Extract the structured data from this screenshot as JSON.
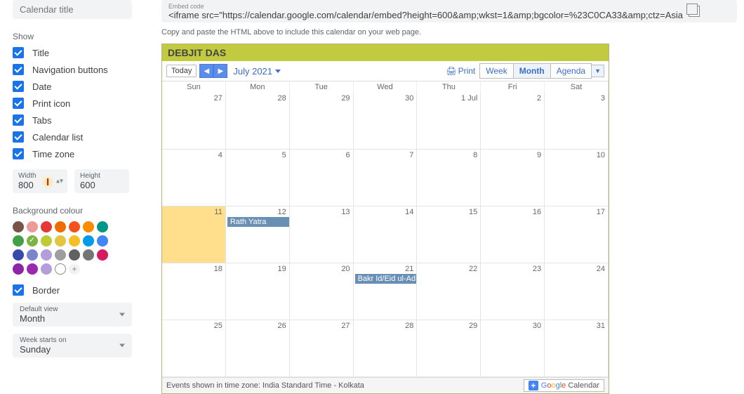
{
  "sidebar": {
    "title_placeholder": "Calendar title",
    "show_label": "Show",
    "checks": [
      {
        "label": "Title"
      },
      {
        "label": "Navigation buttons"
      },
      {
        "label": "Date"
      },
      {
        "label": "Print icon"
      },
      {
        "label": "Tabs"
      },
      {
        "label": "Calendar list"
      },
      {
        "label": "Time zone"
      }
    ],
    "width_label": "Width",
    "width_value": "800",
    "height_label": "Height",
    "height_value": "600",
    "bg_label": "Background colour",
    "colors": [
      "#795548",
      "#ef9a9a",
      "#e53935",
      "#ef6c00",
      "#f4511e",
      "#fb8c00",
      "#009688",
      "#43a047",
      "#7cb342",
      "#c0ca33",
      "#e4c441",
      "#f6bf26",
      "#039be5",
      "#4285f4",
      "#3949ab",
      "#7986cb",
      "#b39ddb",
      "#9e9e9e",
      "#616161",
      "#757575",
      "#d81b60",
      "#8e24aa",
      "#9c27b0",
      "#b39ddb"
    ],
    "selected_color_index": 8,
    "border_label": "Border",
    "default_view_label": "Default view",
    "default_view_value": "Month",
    "week_starts_label": "Week starts on",
    "week_starts_value": "Sunday"
  },
  "main": {
    "embed_label": "Embed code",
    "embed_value": "<iframe src=\"https://calendar.google.com/calendar/embed?height=600&amp;wkst=1&amp;bgcolor=%23C0CA33&amp;ctz=Asia",
    "help_text": "Copy and paste the HTML above to include this calendar on your web page.",
    "calendar": {
      "owner": "DEBJIT DAS",
      "today": "Today",
      "month": "July 2021",
      "print": "Print",
      "tabs": [
        "Week",
        "Month",
        "Agenda"
      ],
      "active_tab": 1,
      "weekdays": [
        "Sun",
        "Mon",
        "Tue",
        "Wed",
        "Thu",
        "Fri",
        "Sat"
      ],
      "cells": [
        {
          "n": "27"
        },
        {
          "n": "28"
        },
        {
          "n": "29"
        },
        {
          "n": "30"
        },
        {
          "n": "1 Jul"
        },
        {
          "n": "2"
        },
        {
          "n": "3"
        },
        {
          "n": "4"
        },
        {
          "n": "5"
        },
        {
          "n": "6"
        },
        {
          "n": "7"
        },
        {
          "n": "8"
        },
        {
          "n": "9"
        },
        {
          "n": "10"
        },
        {
          "n": "11",
          "today": true
        },
        {
          "n": "12",
          "event": "Rath Yatra"
        },
        {
          "n": "13"
        },
        {
          "n": "14"
        },
        {
          "n": "15"
        },
        {
          "n": "16"
        },
        {
          "n": "17"
        },
        {
          "n": "18"
        },
        {
          "n": "19"
        },
        {
          "n": "20"
        },
        {
          "n": "21",
          "event": "Bakr Id/Eid ul-Ad"
        },
        {
          "n": "22"
        },
        {
          "n": "23"
        },
        {
          "n": "24"
        },
        {
          "n": "25"
        },
        {
          "n": "26"
        },
        {
          "n": "27"
        },
        {
          "n": "28"
        },
        {
          "n": "29"
        },
        {
          "n": "30"
        },
        {
          "n": "31"
        }
      ],
      "footer": "Events shown in time zone: India Standard Time - Kolkata",
      "gcal_button": "Google Calendar"
    }
  }
}
